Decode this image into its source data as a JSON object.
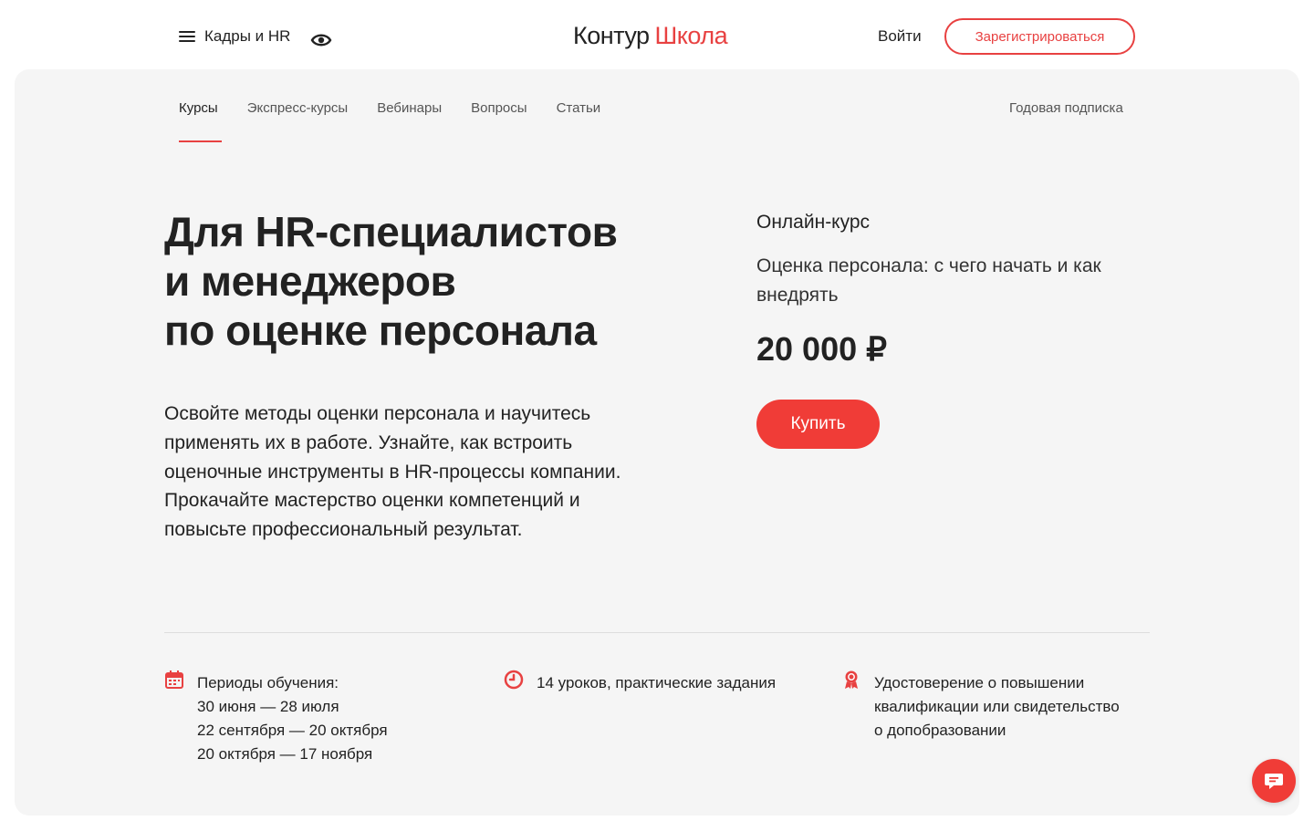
{
  "header": {
    "menu_label": "Кадры и HR",
    "logo_part1": "Контур",
    "logo_part2": "Школа",
    "login_label": "Войти",
    "register_label": "Зарегистрироваться"
  },
  "tabs": [
    {
      "label": "Курсы",
      "active": true
    },
    {
      "label": "Экспресс-курсы"
    },
    {
      "label": "Вебинары"
    },
    {
      "label": "Вопросы"
    },
    {
      "label": "Статьи"
    }
  ],
  "tab_right": "Годовая подписка",
  "hero": {
    "title_lines": [
      "Для HR-специалистов",
      "и менеджеров",
      "по оценке персонала"
    ],
    "description": "Освойте методы оценки персонала и научитесь применять их в работе. Узнайте, как встроить оценочные инструменты в HR-процессы компании. Прокачайте мастерство оценки компетенций и повысьте профессиональный результат."
  },
  "card": {
    "type": "Онлайн-курс",
    "name": "Оценка персонала: с чего начать и как внедрять",
    "price": "20 000 ₽",
    "buy_label": "Купить"
  },
  "features": {
    "periods": {
      "icon": "calendar-icon",
      "lines": [
        "Периоды обучения:",
        "30 июня — 28 июля",
        "22 сентября — 20 октября",
        "20 октября — 17 ноября"
      ]
    },
    "lessons": {
      "icon": "clock-icon",
      "text": "14 уроков, практические задания"
    },
    "certificate": {
      "icon": "award-icon",
      "lines": [
        "Удостоверение о повышении",
        "квалификации или свидетельство",
        "о допобразовании"
      ]
    }
  },
  "colors": {
    "accent": "#f03c37",
    "panel_bg": "#f5f5f5"
  }
}
